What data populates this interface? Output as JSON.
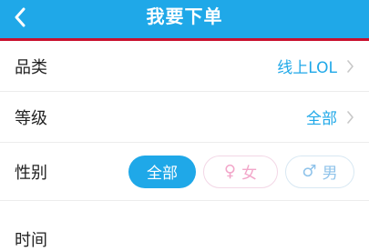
{
  "header": {
    "title": "我要下单",
    "background": "#1fa8e8",
    "underline_color": "#c8102e"
  },
  "rows": {
    "category": {
      "label": "品类",
      "value": "线上LOL"
    },
    "level": {
      "label": "等级",
      "value": "全部"
    },
    "gender": {
      "label": "性别",
      "options": {
        "all": "全部",
        "female": "女",
        "male": "男"
      },
      "selected": "全部"
    },
    "time": {
      "label": "时间"
    }
  },
  "icons": {
    "back": "chevron-left-icon",
    "row_arrow": "chevron-right-icon",
    "female": "female-icon",
    "male": "male-icon"
  },
  "colors": {
    "accent": "#1fa8e8",
    "female": "#f2a6c9",
    "male": "#8fc3ea"
  }
}
